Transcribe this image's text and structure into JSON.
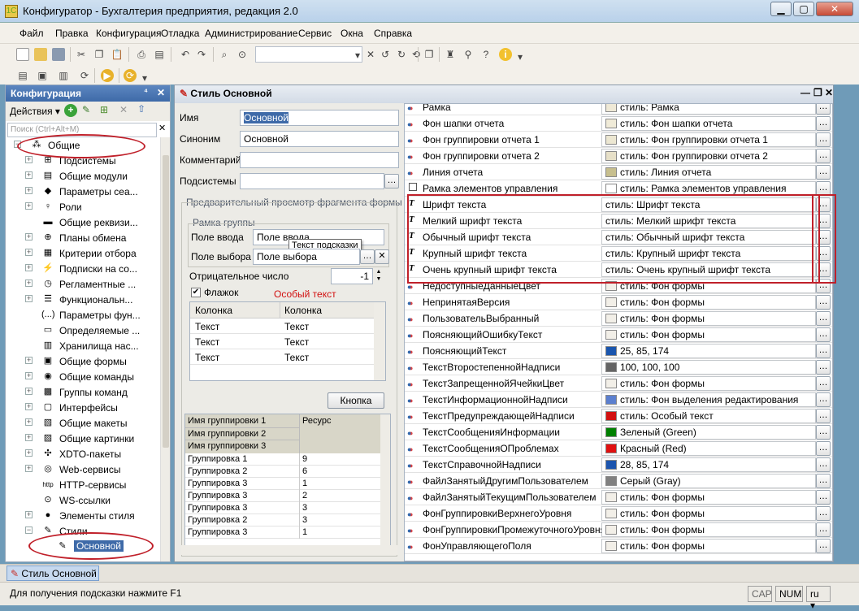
{
  "window": {
    "title": "Конфигуратор - Бухгалтерия предприятия, редакция 2.0",
    "min": "▁",
    "max": "▢",
    "close": "✕"
  },
  "menu": [
    "Файл",
    "Правка",
    "Конфигурация",
    "Отладка",
    "Администрирование",
    "Сервис",
    "Окна",
    "Справка"
  ],
  "left": {
    "title": "Конфигурация",
    "pin": "⁴",
    "close": "✕",
    "actions": "Действия ▾",
    "search_placeholder": "Поиск (Ctrl+Alt+M)",
    "tree": [
      {
        "label": "Общие",
        "icon": "⁂",
        "pm": "−",
        "lvl": 0
      },
      {
        "label": "Подсистемы",
        "icon": "⊞",
        "pm": "+",
        "lvl": 1
      },
      {
        "label": "Общие модули",
        "icon": "▤",
        "pm": "+",
        "lvl": 1
      },
      {
        "label": "Параметры сеа...",
        "icon": "◆",
        "pm": "+",
        "lvl": 1
      },
      {
        "label": "Роли",
        "icon": "♀",
        "pm": "+",
        "lvl": 1
      },
      {
        "label": "Общие реквизи...",
        "icon": "▬",
        "pm": "",
        "lvl": 1
      },
      {
        "label": "Планы обмена",
        "icon": "⊕",
        "pm": "+",
        "lvl": 1
      },
      {
        "label": "Критерии отбора",
        "icon": "▦",
        "pm": "+",
        "lvl": 1
      },
      {
        "label": "Подписки на со...",
        "icon": "⚡",
        "pm": "+",
        "lvl": 1
      },
      {
        "label": "Регламентные ...",
        "icon": "◷",
        "pm": "+",
        "lvl": 1
      },
      {
        "label": "Функциональн...",
        "icon": "☰",
        "pm": "+",
        "lvl": 1
      },
      {
        "label": "Параметры фун...",
        "icon": "(...)",
        "pm": "",
        "lvl": 1
      },
      {
        "label": "Определяемые ...",
        "icon": "▭",
        "pm": "",
        "lvl": 1
      },
      {
        "label": "Хранилища нас...",
        "icon": "▥",
        "pm": "",
        "lvl": 1
      },
      {
        "label": "Общие формы",
        "icon": "▣",
        "pm": "+",
        "lvl": 1
      },
      {
        "label": "Общие команды",
        "icon": "◉",
        "pm": "+",
        "lvl": 1
      },
      {
        "label": "Группы команд",
        "icon": "▩",
        "pm": "+",
        "lvl": 1
      },
      {
        "label": "Интерфейсы",
        "icon": "▢",
        "pm": "+",
        "lvl": 1
      },
      {
        "label": "Общие макеты",
        "icon": "▧",
        "pm": "+",
        "lvl": 1
      },
      {
        "label": "Общие картинки",
        "icon": "▨",
        "pm": "+",
        "lvl": 1
      },
      {
        "label": "XDTO-пакеты",
        "icon": "✣",
        "pm": "+",
        "lvl": 1
      },
      {
        "label": "Web-сервисы",
        "icon": "◎",
        "pm": "+",
        "lvl": 1
      },
      {
        "label": "HTTP-сервисы",
        "icon": "http",
        "pm": "",
        "lvl": 1
      },
      {
        "label": "WS-ссылки",
        "icon": "⊙",
        "pm": "",
        "lvl": 1
      },
      {
        "label": "Элементы стиля",
        "icon": "●",
        "pm": "+",
        "lvl": 1
      },
      {
        "label": "Стили",
        "icon": "✎",
        "pm": "−",
        "lvl": 1
      },
      {
        "label": "Основной",
        "icon": "✎",
        "pm": "",
        "lvl": 2
      }
    ]
  },
  "doc": {
    "title": "Стиль Основной",
    "name_label": "Имя",
    "name_value": "Основной",
    "syn_label": "Синоним",
    "syn_value": "Основной",
    "comment_label": "Комментарий",
    "subsys_label": "Подсистемы",
    "preview_title": "Предварительный просмотр фрагмента формы",
    "group_title": "Рамка группы",
    "input_label": "Поле ввода",
    "input_value": "Поле ввода",
    "tooltip": "Текст подсказки",
    "select_label": "Поле выбора",
    "select_value": "Поле выбора",
    "neg_label": "Отрицательное число",
    "neg_value": "-1",
    "flag_label": "Флажок",
    "special_text": "Особый текст",
    "grid1_cols": [
      "Колонка",
      "Колонка"
    ],
    "grid1_rows": [
      [
        "Текст",
        "Текст"
      ],
      [
        "Текст",
        "Текст"
      ],
      [
        "Текст",
        "Текст"
      ]
    ],
    "button_label": "Кнопка",
    "grid2_head": [
      "Имя группировки 1",
      "Имя группировки 2",
      "Имя группировки 3"
    ],
    "grid2_res": "Ресурс",
    "grid2_rows": [
      [
        "Группировка 1",
        "9"
      ],
      [
        "Группировка 2",
        "6"
      ],
      [
        "Группировка 3",
        "1"
      ],
      [
        "Группировка 3",
        "2"
      ],
      [
        "Группировка 3",
        "3"
      ],
      [
        "Группировка 2",
        "3"
      ],
      [
        "Группировка 3",
        "1"
      ]
    ]
  },
  "styles": [
    {
      "name": "Рамка",
      "value": "стиль: Рамка",
      "icon": "dot",
      "color": "#efe9d6",
      "partial": true
    },
    {
      "name": "Фон шапки отчета",
      "value": "стиль: Фон шапки отчета",
      "icon": "dot",
      "color": "#f0ebd8"
    },
    {
      "name": "Фон группировки отчета 1",
      "value": "стиль: Фон группировки отчета 1",
      "icon": "dot",
      "color": "#ece7d2"
    },
    {
      "name": "Фон группировки отчета 2",
      "value": "стиль: Фон группировки отчета 2",
      "icon": "dot",
      "color": "#e7e0c8"
    },
    {
      "name": "Линия отчета",
      "value": "стиль: Линия отчета",
      "icon": "dot",
      "color": "#c7bf8e"
    },
    {
      "name": "Рамка элементов управления",
      "value": "стиль: Рамка элементов управления",
      "icon": "box",
      "color": "#ffffff"
    },
    {
      "name": "Шрифт текста",
      "value": "стиль: Шрифт текста",
      "icon": "font",
      "color": ""
    },
    {
      "name": "Мелкий шрифт текста",
      "value": "стиль: Мелкий шрифт текста",
      "icon": "font",
      "color": ""
    },
    {
      "name": "Обычный шрифт текста",
      "value": "стиль: Обычный шрифт текста",
      "icon": "font",
      "color": ""
    },
    {
      "name": "Крупный шрифт текста",
      "value": "стиль: Крупный шрифт текста",
      "icon": "font",
      "color": ""
    },
    {
      "name": "Очень крупный шрифт текста",
      "value": "стиль: Очень крупный шрифт текста",
      "icon": "font",
      "color": ""
    },
    {
      "name": "НедоступныеДанныеЦвет",
      "value": "стиль: Фон формы",
      "icon": "dot",
      "color": "#f2efe8"
    },
    {
      "name": "НепринятаяВерсия",
      "value": "стиль: Фон формы",
      "icon": "dot",
      "color": "#f2efe8"
    },
    {
      "name": "ПользовательВыбранный",
      "value": "стиль: Фон формы",
      "icon": "dot",
      "color": "#f2efe8"
    },
    {
      "name": "ПоясняющийОшибкуТекст",
      "value": "стиль: Фон формы",
      "icon": "dot",
      "color": "#f2efe8"
    },
    {
      "name": "ПоясняющийТекст",
      "value": "25, 85, 174",
      "icon": "dot",
      "color": "#1955ae"
    },
    {
      "name": "ТекстВторостепеннойНадписи",
      "value": "100, 100, 100",
      "icon": "dot",
      "color": "#646464"
    },
    {
      "name": "ТекстЗапрещеннойЯчейкиЦвет",
      "value": "стиль: Фон формы",
      "icon": "dot",
      "color": "#f2efe8"
    },
    {
      "name": "ТекстИнформационнойНадписи",
      "value": "стиль: Фон выделения редактирования",
      "icon": "dot",
      "color": "#5b7fcf"
    },
    {
      "name": "ТекстПредупреждающейНадписи",
      "value": "стиль: Особый текст",
      "icon": "dot",
      "color": "#d21010"
    },
    {
      "name": "ТекстСообщенияИнформации",
      "value": "Зеленый (Green)",
      "icon": "dot",
      "color": "#008000"
    },
    {
      "name": "ТекстСообщенияОПроблемах",
      "value": "Красный (Red)",
      "icon": "dot",
      "color": "#e01010"
    },
    {
      "name": "ТекстСправочнойНадписи",
      "value": "28, 85, 174",
      "icon": "dot",
      "color": "#1c55ae"
    },
    {
      "name": "ФайлЗанятыйДругимПользователем",
      "value": "Серый (Gray)",
      "icon": "dot",
      "color": "#808080"
    },
    {
      "name": "ФайлЗанятыйТекущимПользователем",
      "value": "стиль: Фон формы",
      "icon": "dot",
      "color": "#f2efe8"
    },
    {
      "name": "ФонГруппировкиВерхнегоУровня",
      "value": "стиль: Фон формы",
      "icon": "dot",
      "color": "#f2efe8"
    },
    {
      "name": "ФонГруппировкиПромежуточногоУровня",
      "value": "стиль: Фон формы",
      "icon": "dot",
      "color": "#f2efe8"
    },
    {
      "name": "ФонУправляющегоПоля",
      "value": "стиль: Фон формы",
      "icon": "dot",
      "color": "#f2efe8"
    }
  ],
  "taskbar": {
    "item": "Стиль Основной"
  },
  "status": {
    "hint": "Для получения подсказки нажмите F1",
    "cap": "CAP",
    "num": "NUM",
    "lang": "ru ▾"
  },
  "colors": {
    "highlight_red": "#c0202a",
    "selection": "#3e6aa8"
  }
}
